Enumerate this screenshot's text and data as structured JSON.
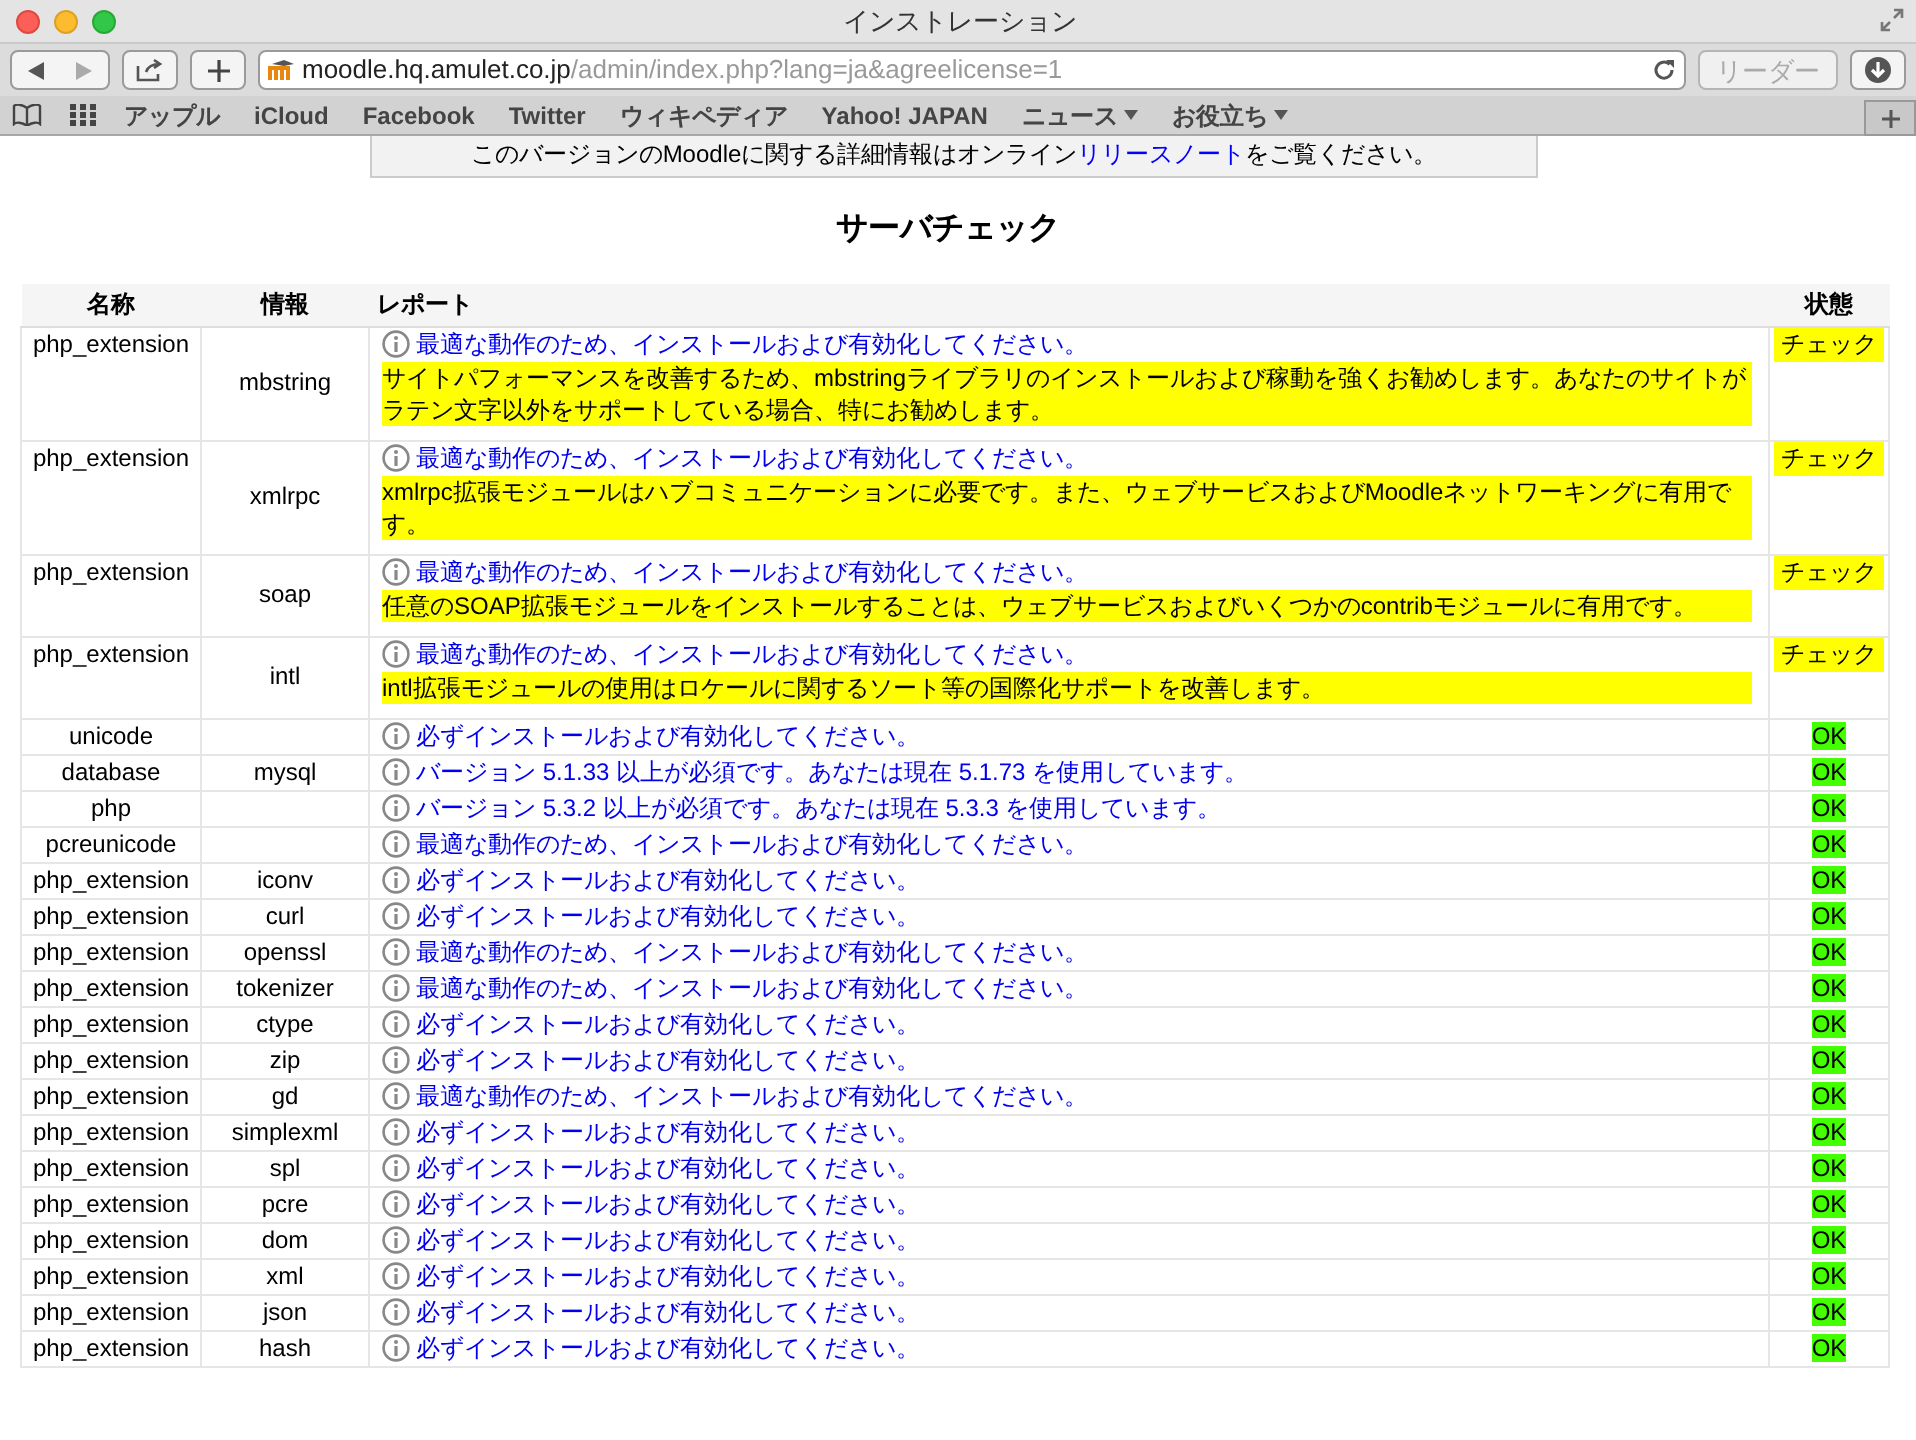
{
  "window": {
    "title": "インストレーション"
  },
  "toolbar": {
    "url_host": "moodle.hq.amulet.co.jp",
    "url_path": "/admin/index.php?lang=ja&agreelicense=1",
    "reader_button": "リーダー"
  },
  "bookmarks": [
    {
      "label": "アップル",
      "menu": false
    },
    {
      "label": "iCloud",
      "menu": false
    },
    {
      "label": "Facebook",
      "menu": false
    },
    {
      "label": "Twitter",
      "menu": false
    },
    {
      "label": "ウィキペディア",
      "menu": false
    },
    {
      "label": "Yahoo! JAPAN",
      "menu": false
    },
    {
      "label": "ニュース",
      "menu": true
    },
    {
      "label": "お役立ち",
      "menu": true
    }
  ],
  "notice": {
    "text": "このバージョンのMoodleに関する詳細情報はオンライン",
    "link": "リリースノート",
    "text_after": "をご覧ください。"
  },
  "heading": "サーバチェック",
  "table": {
    "columns": [
      "名称",
      "情報",
      "レポート",
      "状態"
    ],
    "rows": [
      {
        "name": "php_extension",
        "info": "mbstring",
        "message": "最適な動作のため、インストールおよび有効化してください。",
        "detail": "サイトパフォーマンスを改善するため、mbstringライブラリのインストールおよび稼動を強くお勧めします。あなたのサイトがラテン文字以外をサポートしている場合、特にお勧めします。",
        "status": "チェック",
        "kind": "check"
      },
      {
        "name": "php_extension",
        "info": "xmlrpc",
        "message": "最適な動作のため、インストールおよび有効化してください。",
        "detail": "xmlrpc拡張モジュールはハブコミュニケーションに必要です。また、ウェブサービスおよびMoodleネットワーキングに有用です。",
        "status": "チェック",
        "kind": "check"
      },
      {
        "name": "php_extension",
        "info": "soap",
        "message": "最適な動作のため、インストールおよび有効化してください。",
        "detail": "任意のSOAP拡張モジュールをインストールすることは、ウェブサービスおよびいくつかのcontribモジュールに有用です。",
        "status": "チェック",
        "kind": "check"
      },
      {
        "name": "php_extension",
        "info": "intl",
        "message": "最適な動作のため、インストールおよび有効化してください。",
        "detail": "intl拡張モジュールの使用はロケールに関するソート等の国際化サポートを改善します。",
        "status": "チェック",
        "kind": "check"
      },
      {
        "name": "unicode",
        "message": "必ずインストールおよび有効化してください。",
        "status": "OK",
        "kind": "ok"
      },
      {
        "name": "database",
        "info": "mysql",
        "message": "バージョン 5.1.33 以上が必須です。あなたは現在 5.1.73 を使用しています。",
        "status": "OK",
        "kind": "ok"
      },
      {
        "name": "php",
        "message": "バージョン 5.3.2 以上が必須です。あなたは現在 5.3.3 を使用しています。",
        "status": "OK",
        "kind": "ok"
      },
      {
        "name": "pcreunicode",
        "message": "最適な動作のため、インストールおよび有効化してください。",
        "status": "OK",
        "kind": "ok"
      },
      {
        "name": "php_extension",
        "info": "iconv",
        "message": "必ずインストールおよび有効化してください。",
        "status": "OK",
        "kind": "ok"
      },
      {
        "name": "php_extension",
        "info": "curl",
        "message": "必ずインストールおよび有効化してください。",
        "status": "OK",
        "kind": "ok"
      },
      {
        "name": "php_extension",
        "info": "openssl",
        "message": "最適な動作のため、インストールおよび有効化してください。",
        "status": "OK",
        "kind": "ok"
      },
      {
        "name": "php_extension",
        "info": "tokenizer",
        "message": "最適な動作のため、インストールおよび有効化してください。",
        "status": "OK",
        "kind": "ok"
      },
      {
        "name": "php_extension",
        "info": "ctype",
        "message": "必ずインストールおよび有効化してください。",
        "status": "OK",
        "kind": "ok"
      },
      {
        "name": "php_extension",
        "info": "zip",
        "message": "必ずインストールおよび有効化してください。",
        "status": "OK",
        "kind": "ok"
      },
      {
        "name": "php_extension",
        "info": "gd",
        "message": "最適な動作のため、インストールおよび有効化してください。",
        "status": "OK",
        "kind": "ok"
      },
      {
        "name": "php_extension",
        "info": "simplexml",
        "message": "必ずインストールおよび有効化してください。",
        "status": "OK",
        "kind": "ok"
      },
      {
        "name": "php_extension",
        "info": "spl",
        "message": "必ずインストールおよび有効化してください。",
        "status": "OK",
        "kind": "ok"
      },
      {
        "name": "php_extension",
        "info": "pcre",
        "message": "必ずインストールおよび有効化してください。",
        "status": "OK",
        "kind": "ok"
      },
      {
        "name": "php_extension",
        "info": "dom",
        "message": "必ずインストールおよび有効化してください。",
        "status": "OK",
        "kind": "ok"
      },
      {
        "name": "php_extension",
        "info": "xml",
        "message": "必ずインストールおよび有効化してください。",
        "status": "OK",
        "kind": "ok"
      },
      {
        "name": "php_extension",
        "info": "json",
        "message": "必ずインストールおよび有効化してください。",
        "status": "OK",
        "kind": "ok"
      },
      {
        "name": "php_extension",
        "info": "hash",
        "message": "必ずインストールおよび有効化してください。",
        "status": "OK",
        "kind": "ok"
      }
    ]
  }
}
